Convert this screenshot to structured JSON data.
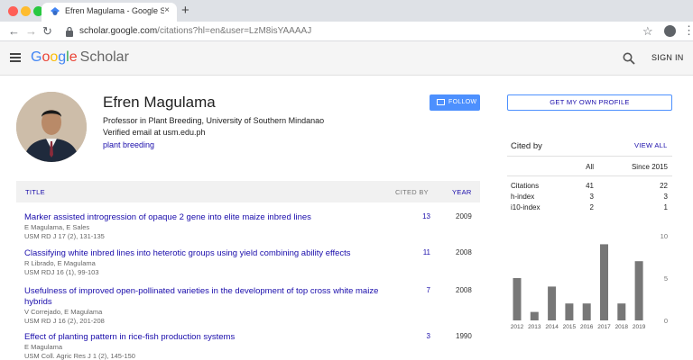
{
  "browser": {
    "tab_title": "Efren Magulama - Google Scholar",
    "tab_close": "×",
    "new_tab": "+",
    "url_host": "scholar.google.com",
    "url_path": "/citations?hl=en&user=LzM8isYAAAAJ",
    "traffic_colors": [
      "#ff5f57",
      "#febc2e",
      "#28c840"
    ]
  },
  "header": {
    "logo_letters": [
      "G",
      "o",
      "o",
      "g",
      "l",
      "e"
    ],
    "logo_product": "Scholar",
    "signin_label": "SIGN IN"
  },
  "profile": {
    "name": "Efren Magulama",
    "affiliation": "Professor in Plant Breeding, University of Southern Mindanao",
    "verified": "Verified email at usm.edu.ph",
    "interest": "plant breeding",
    "follow_label": "FOLLOW"
  },
  "table": {
    "col_title": "TITLE",
    "col_cited": "CITED BY",
    "col_year": "YEAR",
    "articles": [
      {
        "title": "Marker assisted introgression of opaque 2 gene into elite maize inbred lines",
        "authors": "E Magulama, E Sales",
        "journal": "USM RD J 17 (2), 131-135",
        "cited": "13",
        "year": "2009"
      },
      {
        "title": "Classifying white inbred lines into heterotic groups using yield combining ability effects",
        "authors": "R Librado, E Magulama",
        "journal": "USM RDJ 16 (1), 99-103",
        "cited": "11",
        "year": "2008"
      },
      {
        "title": "Usefulness of improved open-pollinated varieties in the development of top cross white maize hybrids",
        "authors": "V Correjado, E Magulama",
        "journal": "USM RD J 16 (2), 201-208",
        "cited": "7",
        "year": "2008"
      },
      {
        "title": "Effect of planting pattern in rice-fish production systems",
        "authors": "E Magulama",
        "journal": "USM Coll. Agric Res J 1 (2), 145-150",
        "cited": "3",
        "year": "1990"
      }
    ]
  },
  "sidebar": {
    "get_profile_label": "GET MY OWN PROFILE",
    "cited_by_title": "Cited by",
    "view_all_label": "VIEW ALL",
    "col_all": "All",
    "col_since": "Since 2015",
    "metrics": [
      {
        "label": "Citations",
        "all": "41",
        "since": "22"
      },
      {
        "label": "h-index",
        "all": "3",
        "since": "3"
      },
      {
        "label": "i10-index",
        "all": "2",
        "since": "1"
      }
    ]
  },
  "chart_data": {
    "type": "bar",
    "categories": [
      "2012",
      "2013",
      "2014",
      "2015",
      "2016",
      "2017",
      "2018",
      "2019"
    ],
    "values": [
      5,
      1,
      4,
      2,
      2,
      9,
      2,
      7
    ],
    "ylim": [
      0,
      10
    ],
    "yticks": [
      "10",
      "5",
      "0"
    ],
    "bar_color": "#777777"
  }
}
